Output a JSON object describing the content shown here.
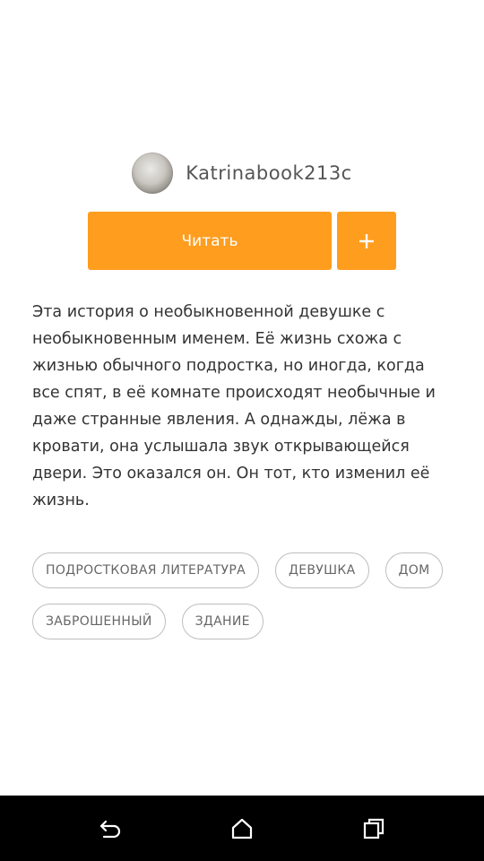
{
  "author": {
    "name": "Katrinabook213c",
    "avatar_icon": "avatar-photo"
  },
  "actions": {
    "read_label": "Читать",
    "add_icon": "plus-icon",
    "accent_color": "#ff9d1e"
  },
  "description": "Эта история о необыкновенной девушке с необыкновенным именем. Её жизнь схожа с жизнью обычного подростка, но иногда, когда все спят, в её комнате происходят необычные и даже странные явления. А однажды, лёжа в кровати, она услышала звук открывающейся двери. Это оказался он. Он тот, кто изменил её жизнь.",
  "tags": [
    "ПОДРОСТКОВАЯ ЛИТЕРАТУРА",
    "ДЕВУШКА",
    "ДОМ",
    "ЗАБРОШЕННЫЙ",
    "ЗДАНИЕ"
  ],
  "navbar": {
    "back_icon": "back-icon",
    "home_icon": "home-icon",
    "recents_icon": "recents-icon"
  }
}
